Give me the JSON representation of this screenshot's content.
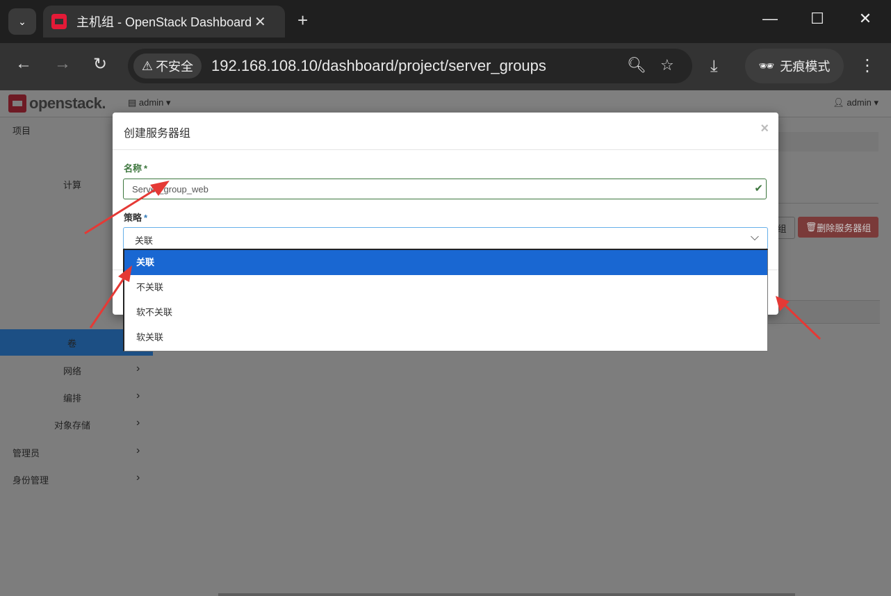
{
  "browser": {
    "tab_title": "主机组 - OpenStack Dashboard",
    "security_label": "不安全",
    "url": "192.168.108.10/dashboard/project/server_groups",
    "incognito_label": "无痕模式"
  },
  "header": {
    "logo_text": "openstack.",
    "project": "admin",
    "user": "admin"
  },
  "sidebar": {
    "items": [
      {
        "label": "项目"
      },
      {
        "label": "计算"
      },
      {
        "label": "卷"
      },
      {
        "label": "网络"
      },
      {
        "label": "编排"
      },
      {
        "label": "对象存储"
      },
      {
        "label": "管理员"
      },
      {
        "label": "身份管理"
      }
    ]
  },
  "content": {
    "partial_button": "组",
    "delete_button": "删除服务器组"
  },
  "modal": {
    "title": "创建服务器组",
    "close": "×",
    "name_label": "名称",
    "name_value": "Server_group_web",
    "policy_label": "策略",
    "policy_value": "关联",
    "required_mark": "*",
    "options": [
      "关联",
      "不关联",
      "软不关联",
      "软关联"
    ],
    "selected_option": "关联"
  },
  "annotation_color": "#e53935"
}
